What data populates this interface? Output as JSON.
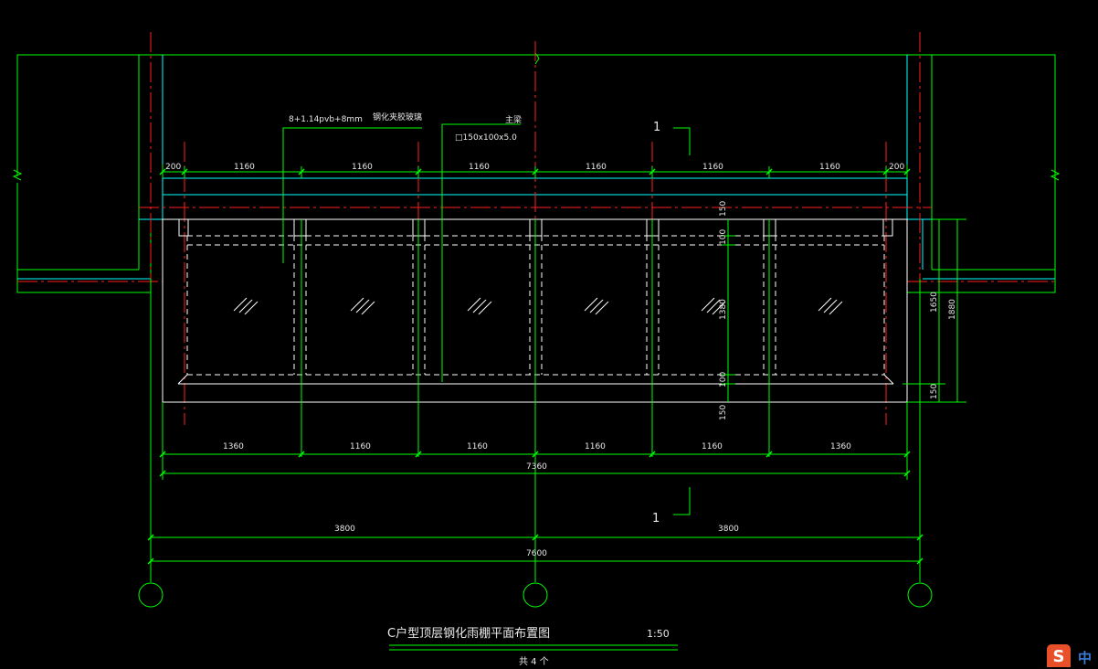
{
  "drawing": {
    "title": "C户型顶层钢化雨棚平面布置图",
    "scale": "1:50",
    "subnote": "共 4 个",
    "section_mark": "1"
  },
  "annotations": {
    "glass_spec": "8+1.14pvb+8mm",
    "glass_name": "钢化夹胶玻璃",
    "main_beam": "主梁",
    "beam_size": "□150x100x5.0"
  },
  "dims": {
    "top": [
      "200",
      "1160",
      "1160",
      "1160",
      "1160",
      "1160",
      "1160",
      "200"
    ],
    "bottom": [
      "1360",
      "1160",
      "1160",
      "1160",
      "1160",
      "1360"
    ],
    "total_inner": "7360",
    "axis": [
      "3800",
      "3800"
    ],
    "total_axis": "7600",
    "vertical_inner": [
      "150",
      "100",
      "1380",
      "100",
      "150"
    ],
    "vertical_outer": [
      "1650",
      "1880"
    ]
  },
  "ime": {
    "logo": "S",
    "lang": "中"
  },
  "colors": {
    "background": "#000000",
    "green": "#00ff00",
    "cyan": "#00ffff",
    "red": "#ff2020",
    "white": "#ffffff"
  }
}
